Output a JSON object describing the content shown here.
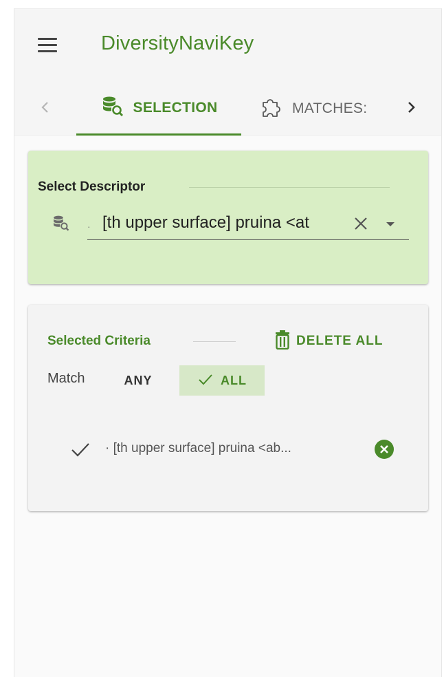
{
  "app": {
    "title": "DiversityNaviKey"
  },
  "tabs": [
    {
      "label": "SELECTION",
      "icon": "database-search-icon",
      "active": true
    },
    {
      "label": "MATCHES:",
      "icon": "puzzle-icon",
      "active": false
    }
  ],
  "descriptor_card": {
    "heading": "Select Descriptor",
    "select_value": "[th upper surface] pruina <at",
    "bullet": "·"
  },
  "criteria_card": {
    "heading": "Selected Criteria",
    "delete_all_label": "DELETE ALL",
    "match_label": "Match",
    "any_label": "ANY",
    "all_label": "ALL",
    "selected_mode": "ALL",
    "items": [
      {
        "text": "· [th upper surface] pruina <ab..."
      }
    ]
  },
  "colors": {
    "brand_green": "#4a8a2a",
    "descriptor_card_bg": "#d9eec5",
    "all_button_bg": "#d7e8c8"
  }
}
